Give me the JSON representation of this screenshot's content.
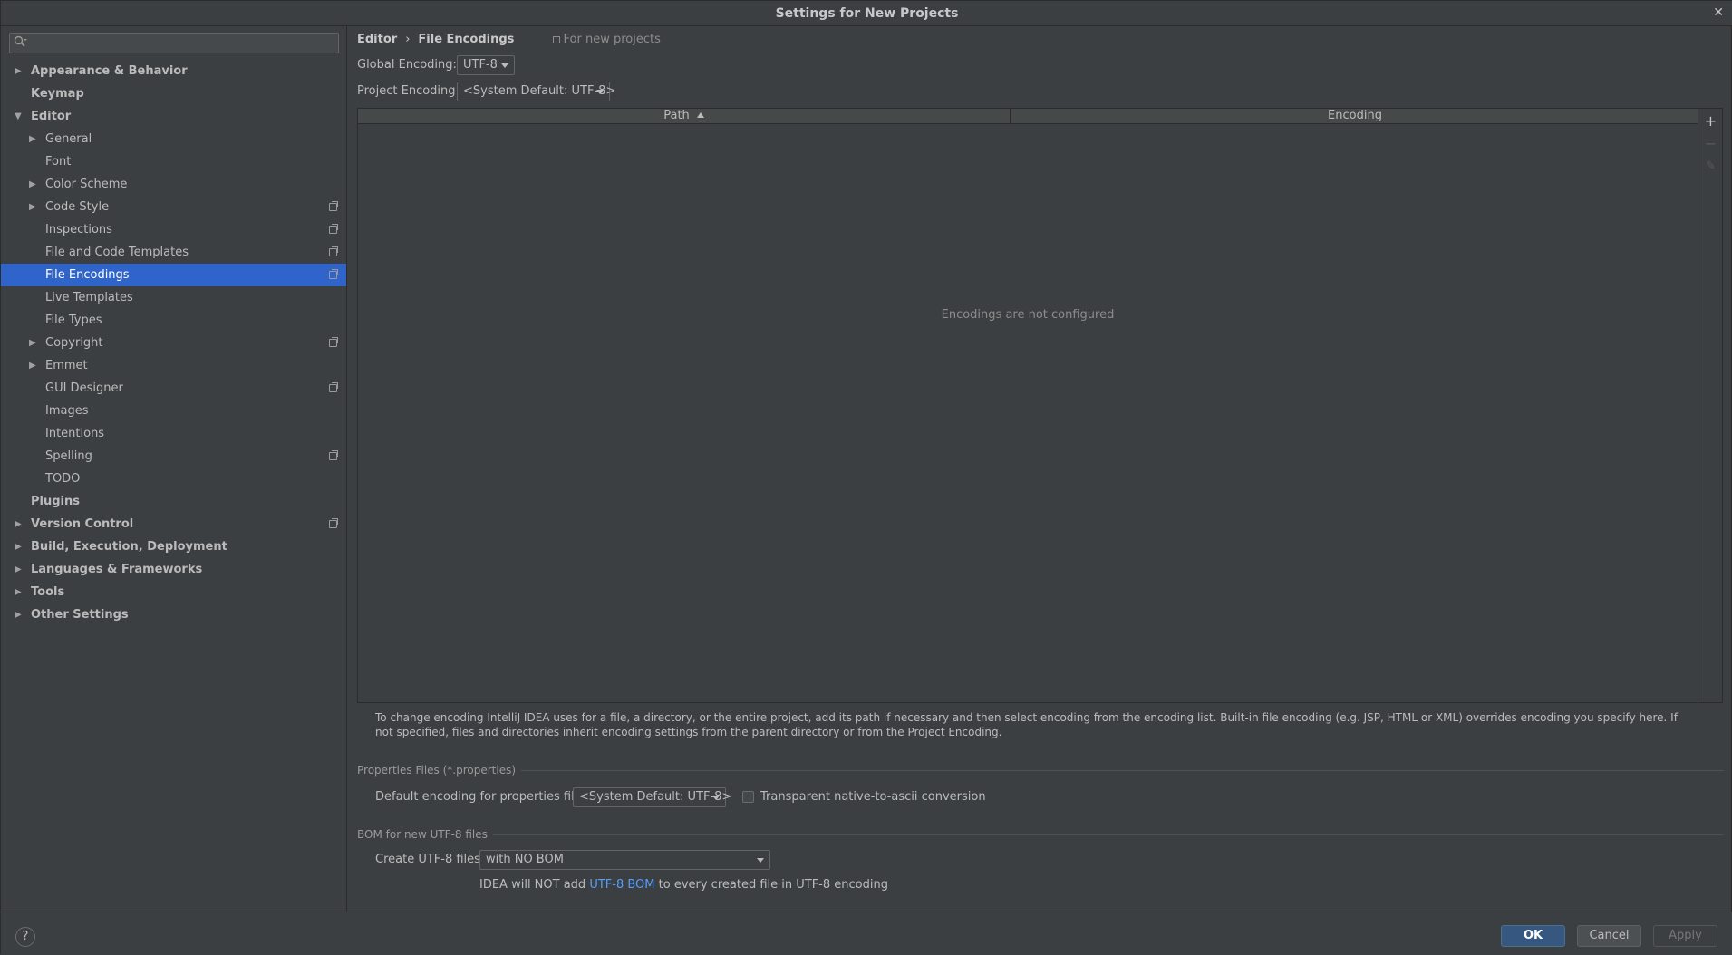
{
  "window": {
    "title": "Settings for New Projects",
    "close_glyph": "✕"
  },
  "search": {
    "placeholder": "",
    "value": ""
  },
  "sidebar": {
    "items": [
      {
        "label": "Appearance & Behavior",
        "level": 0,
        "arrow": "right",
        "proj": false
      },
      {
        "label": "Keymap",
        "level": 0,
        "arrow": "none",
        "proj": false
      },
      {
        "label": "Editor",
        "level": 0,
        "arrow": "down",
        "proj": false
      },
      {
        "label": "General",
        "level": 1,
        "arrow": "right",
        "proj": false
      },
      {
        "label": "Font",
        "level": 1,
        "arrow": "none",
        "proj": false
      },
      {
        "label": "Color Scheme",
        "level": 1,
        "arrow": "right",
        "proj": false
      },
      {
        "label": "Code Style",
        "level": 1,
        "arrow": "right",
        "proj": true
      },
      {
        "label": "Inspections",
        "level": 1,
        "arrow": "none",
        "proj": true
      },
      {
        "label": "File and Code Templates",
        "level": 1,
        "arrow": "none",
        "proj": true
      },
      {
        "label": "File Encodings",
        "level": 1,
        "arrow": "none",
        "proj": true,
        "selected": true
      },
      {
        "label": "Live Templates",
        "level": 1,
        "arrow": "none",
        "proj": false
      },
      {
        "label": "File Types",
        "level": 1,
        "arrow": "none",
        "proj": false
      },
      {
        "label": "Copyright",
        "level": 1,
        "arrow": "right",
        "proj": true
      },
      {
        "label": "Emmet",
        "level": 1,
        "arrow": "right",
        "proj": false
      },
      {
        "label": "GUI Designer",
        "level": 1,
        "arrow": "none",
        "proj": true
      },
      {
        "label": "Images",
        "level": 1,
        "arrow": "none",
        "proj": false
      },
      {
        "label": "Intentions",
        "level": 1,
        "arrow": "none",
        "proj": false
      },
      {
        "label": "Spelling",
        "level": 1,
        "arrow": "none",
        "proj": true
      },
      {
        "label": "TODO",
        "level": 1,
        "arrow": "none",
        "proj": false
      },
      {
        "label": "Plugins",
        "level": 0,
        "arrow": "none",
        "proj": false
      },
      {
        "label": "Version Control",
        "level": 0,
        "arrow": "right",
        "proj": true
      },
      {
        "label": "Build, Execution, Deployment",
        "level": 0,
        "arrow": "right",
        "proj": false
      },
      {
        "label": "Languages & Frameworks",
        "level": 0,
        "arrow": "right",
        "proj": false
      },
      {
        "label": "Tools",
        "level": 0,
        "arrow": "right",
        "proj": false
      },
      {
        "label": "Other Settings",
        "level": 0,
        "arrow": "right",
        "proj": false
      }
    ]
  },
  "breadcrumb": {
    "parent": "Editor",
    "separator": "›",
    "current": "File Encodings",
    "scope": "For new projects"
  },
  "global_encoding": {
    "label": "Global Encoding:",
    "value": "UTF-8"
  },
  "project_encoding": {
    "label": "Project Encoding:",
    "value": "<System Default: UTF-8>"
  },
  "table": {
    "columns": [
      "Path",
      "Encoding"
    ],
    "empty_text": "Encodings are not configured",
    "tools": {
      "add": "+",
      "remove": "−",
      "edit": "✎"
    }
  },
  "description": "To change encoding IntelliJ IDEA uses for a file, a directory, or the entire project, add its path if necessary and then select encoding from the encoding list. Built-in file encoding (e.g. JSP, HTML or XML) overrides encoding you specify here. If not specified, files and directories inherit encoding settings from the parent directory or from the Project Encoding.",
  "properties_section": {
    "title": "Properties Files (*.properties)",
    "default_label": "Default encoding for properties files:",
    "default_value": "<System Default: UTF-8>",
    "transparent_label": "Transparent native-to-ascii conversion",
    "transparent_checked": false
  },
  "bom_section": {
    "title": "BOM for new UTF-8 files",
    "create_label": "Create UTF-8 files:",
    "create_value": "with NO BOM",
    "note_before": "IDEA will NOT add ",
    "note_link": "UTF-8 BOM",
    "note_after": " to every created file in UTF-8 encoding"
  },
  "footer": {
    "help": "?",
    "ok": "OK",
    "cancel": "Cancel",
    "apply": "Apply"
  }
}
